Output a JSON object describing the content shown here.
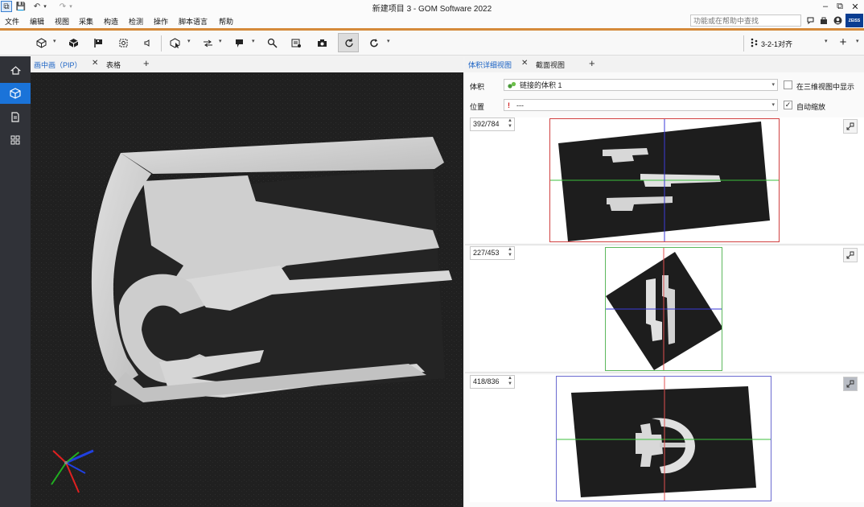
{
  "titlebar": {
    "title": "新建项目 3 - GOM Software 2022",
    "quick_access": [
      "⧉",
      "💾",
      "↶",
      "▾",
      "↷",
      "▾"
    ],
    "window_buttons": [
      "–",
      "⧉",
      "✕"
    ]
  },
  "menubar": {
    "items": [
      "文件",
      "编辑",
      "视图",
      "采集",
      "构造",
      "检测",
      "操作",
      "脚本语言",
      "帮助"
    ],
    "search_placeholder": "功能或在帮助中查找",
    "logo_text": "ZEISS"
  },
  "toolbar": {
    "align_label": "3-2-1对齐",
    "plus": "+",
    "caret": "▾"
  },
  "left_panel": {
    "tabs": [
      {
        "label": "画中画（PIP）",
        "active": true
      },
      {
        "label": "表格",
        "active": false
      }
    ],
    "close": "✕",
    "add": "+"
  },
  "right_panel": {
    "tabs": [
      {
        "label": "体积详细视图",
        "active": true
      },
      {
        "label": "截面视图",
        "active": false
      }
    ],
    "close": "✕",
    "add": "+",
    "volume_label": "体积",
    "volume_value": "链接的体积 1",
    "position_label": "位置",
    "position_value": "---",
    "show_in_3d_label": "在三维视图中显示",
    "show_in_3d_checked": false,
    "auto_zoom_label": "自动缩放",
    "auto_zoom_checked": true,
    "check_mark": "✓",
    "slices": [
      {
        "value": "392/784",
        "frame_color": "#d04040"
      },
      {
        "value": "227/453",
        "frame_color": "#5cb85c"
      },
      {
        "value": "418/836",
        "frame_color": "#6a6ad0"
      }
    ]
  },
  "colors": {
    "accent": "#1a73d9",
    "orange_line": "#d58a3b",
    "sidebar_bg": "#303238",
    "axis_red": "#e02020",
    "axis_green": "#20b020",
    "axis_blue": "#2040e0"
  }
}
